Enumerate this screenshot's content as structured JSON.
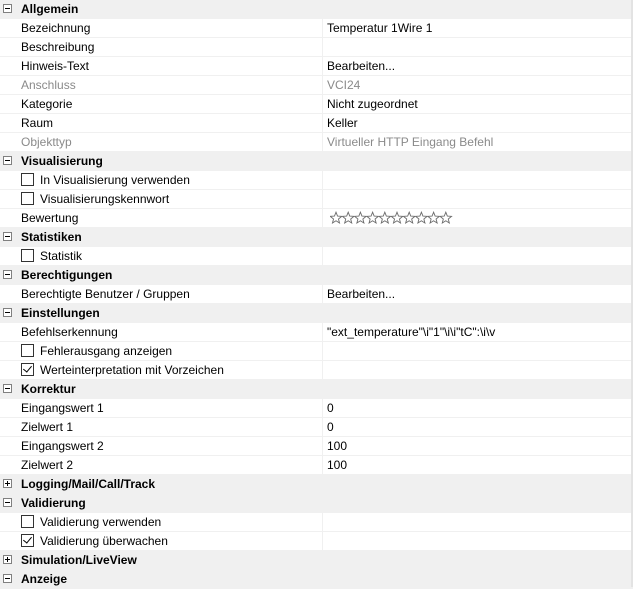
{
  "categories": {
    "allgemein": "Allgemein",
    "visualisierung": "Visualisierung",
    "statistiken": "Statistiken",
    "berechtigungen": "Berechtigungen",
    "einstellungen": "Einstellungen",
    "korrektur": "Korrektur",
    "logging": "Logging/Mail/Call/Track",
    "validierung": "Validierung",
    "simulation": "Simulation/LiveView",
    "anzeige": "Anzeige"
  },
  "allgemein": {
    "bezeichnung": {
      "name": "Bezeichnung",
      "value": "Temperatur 1Wire 1"
    },
    "beschreibung": {
      "name": "Beschreibung",
      "value": ""
    },
    "hinweis": {
      "name": "Hinweis-Text",
      "value": "Bearbeiten..."
    },
    "anschluss": {
      "name": "Anschluss",
      "value": "VCI24"
    },
    "kategorie": {
      "name": "Kategorie",
      "value": "Nicht zugeordnet"
    },
    "raum": {
      "name": "Raum",
      "value": "Keller"
    },
    "objekttyp": {
      "name": "Objekttyp",
      "value": "Virtueller HTTP Eingang Befehl"
    }
  },
  "visualisierung": {
    "in_vis": {
      "name": "In Visualisierung verwenden",
      "checked": false
    },
    "kennwort": {
      "name": "Visualisierungskennwort",
      "checked": false
    },
    "bewertung": {
      "name": "Bewertung",
      "stars": 10,
      "rating": 0
    }
  },
  "statistiken": {
    "statistik": {
      "name": "Statistik",
      "checked": false
    }
  },
  "berechtigungen": {
    "benutzer": {
      "name": "Berechtigte Benutzer / Gruppen",
      "value": "Bearbeiten..."
    }
  },
  "einstellungen": {
    "befehlserkennung": {
      "name": "Befehlserkennung",
      "value": "\"ext_temperature\"\\i\"1\"\\i\\i\"tC\":\\i\\v"
    },
    "fehlerausgang": {
      "name": "Fehlerausgang anzeigen",
      "checked": false
    },
    "werteinterpretation": {
      "name": "Werteinterpretation mit Vorzeichen",
      "checked": true
    }
  },
  "korrektur": {
    "eingangswert1": {
      "name": "Eingangswert 1",
      "value": "0"
    },
    "zielwert1": {
      "name": "Zielwert 1",
      "value": "0"
    },
    "eingangswert2": {
      "name": "Eingangswert 2",
      "value": "100"
    },
    "zielwert2": {
      "name": "Zielwert 2",
      "value": "100"
    }
  },
  "validierung": {
    "verwenden": {
      "name": "Validierung verwenden",
      "checked": false
    },
    "ueberwachen": {
      "name": "Validierung überwachen",
      "checked": true
    }
  },
  "colors": {
    "category_bg": "#f0f0f0",
    "disabled_text": "#8a8a8a"
  }
}
